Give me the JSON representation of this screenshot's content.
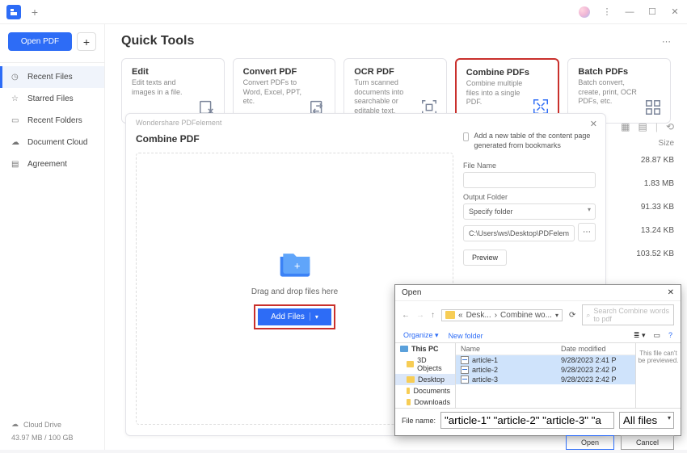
{
  "titlebar": {},
  "sidebar": {
    "open_label": "Open PDF",
    "items": [
      {
        "label": "Recent Files"
      },
      {
        "label": "Starred Files"
      },
      {
        "label": "Recent Folders"
      },
      {
        "label": "Document Cloud"
      },
      {
        "label": "Agreement"
      }
    ],
    "cloud_label": "Cloud Drive",
    "storage": "43.97 MB / 100 GB"
  },
  "main": {
    "title": "Quick Tools",
    "cards": [
      {
        "title": "Edit",
        "desc": "Edit texts and images in a file."
      },
      {
        "title": "Convert PDF",
        "desc": "Convert PDFs to Word, Excel, PPT, etc."
      },
      {
        "title": "OCR PDF",
        "desc": "Turn scanned documents into searchable or editable text."
      },
      {
        "title": "Combine PDFs",
        "desc": "Combine multiple files into a single PDF."
      },
      {
        "title": "Batch PDFs",
        "desc": "Batch convert, create, print, OCR PDFs, etc."
      }
    ]
  },
  "panel": {
    "app_title": "Wondershare PDFelement",
    "title": "Combine PDF",
    "dropzone_text": "Drag and drop files here",
    "add_files": "Add Files",
    "checkbox_text": "Add a new table of the content page generated from bookmarks",
    "filename_label": "File Name",
    "outputfolder_label": "Output Folder",
    "specify_folder": "Specify folder",
    "path": "C:\\Users\\ws\\Desktop\\PDFelement\\Con",
    "preview": "Preview"
  },
  "rightcol": {
    "size_head": "Size",
    "sizes": [
      "28.87 KB",
      "1.83 MB",
      "91.33 KB",
      "13.24 KB",
      "103.52 KB"
    ]
  },
  "dialog": {
    "title": "Open",
    "path_parts": [
      "Desk...",
      "Combine wo..."
    ],
    "search_placeholder": "Search Combine words to pdf",
    "organize": "Organize",
    "new_folder": "New folder",
    "tree": [
      "This PC",
      "3D Objects",
      "Desktop",
      "Documents",
      "Downloads"
    ],
    "col_name": "Name",
    "col_date": "Date modified",
    "files": [
      {
        "name": "article-1",
        "date": "9/28/2023 2:41 P"
      },
      {
        "name": "article-2",
        "date": "9/28/2023 2:42 P"
      },
      {
        "name": "article-3",
        "date": "9/28/2023 2:42 P"
      }
    ],
    "preview_text": "This file can't be previewed.",
    "filename_label": "File name:",
    "filename_value": "\"article-1\" \"article-2\" \"article-3\" \"a",
    "filter": "All files",
    "open_btn": "Open",
    "cancel_btn": "Cancel"
  }
}
